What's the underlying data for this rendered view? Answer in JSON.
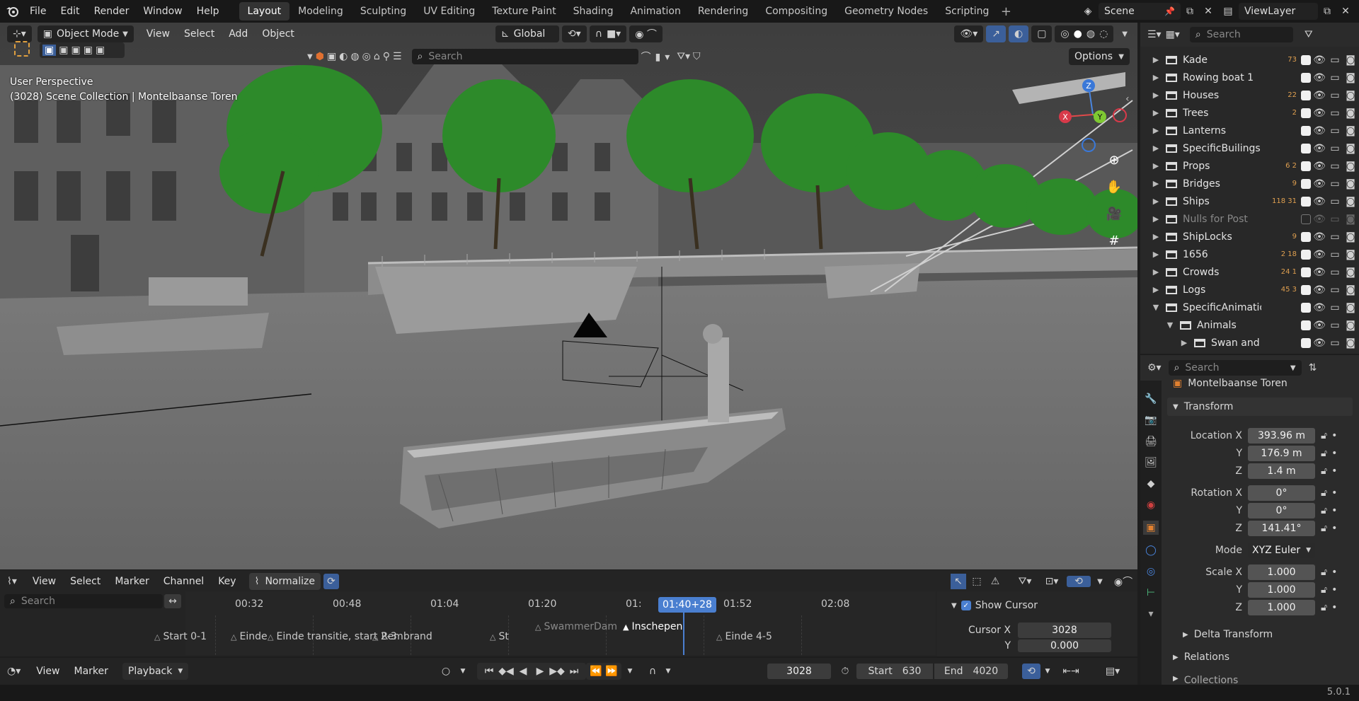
{
  "topbar": {
    "menus": [
      "File",
      "Edit",
      "Render",
      "Window",
      "Help"
    ],
    "workspaces": [
      "Layout",
      "Modeling",
      "Sculpting",
      "UV Editing",
      "Texture Paint",
      "Shading",
      "Animation",
      "Rendering",
      "Compositing",
      "Geometry Nodes",
      "Scripting"
    ],
    "active_workspace": "Layout",
    "scene": "Scene",
    "view_layer": "ViewLayer"
  },
  "viewport": {
    "mode": "Object Mode",
    "menus": [
      "View",
      "Select",
      "Add",
      "Object"
    ],
    "orientation": "Global",
    "search_placeholder": "Search",
    "options_label": "Options",
    "perspective": "User Perspective",
    "collection_info": "(3028) Scene Collection | Montelbaanse Toren",
    "gizmo_axes": [
      "Z",
      "X",
      "Y"
    ]
  },
  "outliner": {
    "search_placeholder": "Search",
    "rows": [
      {
        "name": "Kade",
        "count": "73"
      },
      {
        "name": "Rowing boat 1",
        "count": ""
      },
      {
        "name": "Houses",
        "count": "22"
      },
      {
        "name": "Trees",
        "count": "2"
      },
      {
        "name": "Lanterns",
        "count": ""
      },
      {
        "name": "SpecificBuilings",
        "count": ""
      },
      {
        "name": "Props",
        "count": "6 2"
      },
      {
        "name": "Bridges",
        "count": "9"
      },
      {
        "name": "Ships",
        "count": "118 31"
      },
      {
        "name": "Nulls for Post",
        "count": ""
      },
      {
        "name": "ShipLocks",
        "count": "9"
      },
      {
        "name": "1656",
        "count": "2 18"
      },
      {
        "name": "Crowds",
        "count": "24 1"
      },
      {
        "name": "Logs",
        "count": "45 3"
      },
      {
        "name": "SpecificAnimations",
        "count": ""
      },
      {
        "name": "Animals",
        "count": ""
      },
      {
        "name": "Swan and",
        "count": ""
      }
    ]
  },
  "properties": {
    "search_placeholder": "Search",
    "object_name": "Montelbaanse Toren",
    "section_transform": "Transform",
    "location_label": "Location X",
    "location": [
      "393.96 m",
      "176.9 m",
      "1.4 m"
    ],
    "rotation_label": "Rotation X",
    "rotation": [
      "0°",
      "0°",
      "141.41°"
    ],
    "mode_label": "Mode",
    "mode_value": "XYZ Euler",
    "scale_label": "Scale X",
    "scale": [
      "1.000",
      "1.000",
      "1.000"
    ],
    "y_label": "Y",
    "z_label": "Z",
    "delta_transform": "Delta Transform",
    "relations": "Relations",
    "collections": "Collections"
  },
  "timeline": {
    "menus": [
      "View",
      "Select",
      "Marker",
      "Channel",
      "Key"
    ],
    "normalize": "Normalize",
    "search_placeholder": "Search",
    "ticks": [
      "00:32",
      "00:48",
      "01:04",
      "01:20",
      "01:",
      "01:52",
      "02:08"
    ],
    "current_time": "01:40+28",
    "markers": [
      "Start 0-1",
      "Einde",
      "Einde transitie, start 2-3",
      "Rembrand",
      "St",
      "SwammerDam",
      "Inschepen",
      "Einde 4-5"
    ],
    "show_cursor": "Show Cursor",
    "cursor_x_label": "Cursor X",
    "cursor_x": "3028",
    "cursor_y_label": "Y",
    "cursor_y": "0.000"
  },
  "playback": {
    "menus": [
      "View",
      "Marker"
    ],
    "playback": "Playback",
    "current_frame": "3028",
    "start_label": "Start",
    "start": "630",
    "end_label": "End",
    "end": "4020"
  },
  "status": {
    "version": "5.0.1"
  }
}
